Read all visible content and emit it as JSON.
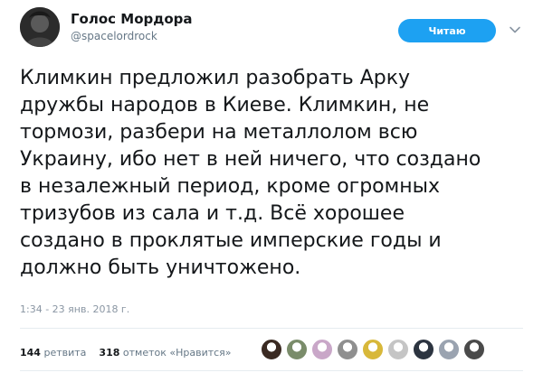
{
  "author": {
    "display_name": "Голос Мордора",
    "handle": "@spacelordrock"
  },
  "follow_button": {
    "label": "Читаю"
  },
  "tweet": {
    "lines": [
      "Климкин предложил разобрать Арку",
      "дружбы народов в Киеве. Климкин, не",
      "тормози, разбери на металлолом всю",
      "Украину, ибо нет в ней ничего, что создано",
      "в незалежный период, кроме огромных",
      "тризубов из сала и т.д. Всё хорошее",
      "создано в проклятые имперские годы и",
      "должно быть уничтожено."
    ],
    "timestamp": "1:34 - 23 янв. 2018 г."
  },
  "stats": {
    "retweets_count": "144",
    "retweets_label": "ретвита",
    "likes_count": "318",
    "likes_label": "отметок «Нравится»"
  },
  "likers": [
    {
      "name": "liker-avatar-1",
      "color": "#3a2a22"
    },
    {
      "name": "liker-avatar-2",
      "color": "#7a8c6a"
    },
    {
      "name": "liker-avatar-3",
      "color": "#c9a7c8"
    },
    {
      "name": "liker-avatar-4",
      "color": "#8f8f8f"
    },
    {
      "name": "liker-avatar-5",
      "color": "#d8b83a"
    },
    {
      "name": "liker-avatar-6",
      "color": "#c5c5c5"
    },
    {
      "name": "liker-avatar-7",
      "color": "#2c3440"
    },
    {
      "name": "liker-avatar-8",
      "color": "#9aa3b0"
    },
    {
      "name": "liker-avatar-9",
      "color": "#4a4a4a"
    }
  ],
  "colors": {
    "accent": "#1da1f2",
    "text": "#14171a",
    "muted": "#657786"
  }
}
